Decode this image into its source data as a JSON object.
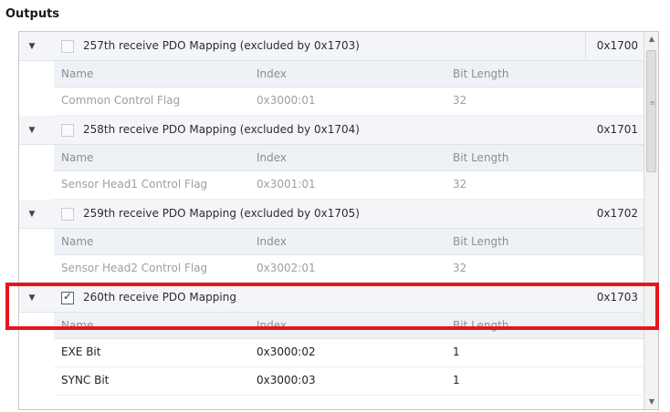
{
  "section": {
    "title": "Outputs"
  },
  "columns": {
    "name": "Name",
    "index": "Index",
    "bit_length": "Bit Length"
  },
  "groups": [
    {
      "title": "257th receive PDO Mapping (excluded by 0x1703)",
      "index": "0x1700",
      "checked": false,
      "rows": [
        {
          "name": "Common Control Flag",
          "index": "0x3000:01",
          "bits": "32"
        }
      ]
    },
    {
      "title": "258th receive PDO Mapping (excluded by 0x1704)",
      "index": "0x1701",
      "checked": false,
      "rows": [
        {
          "name": "Sensor Head1 Control Flag",
          "index": "0x3001:01",
          "bits": "32"
        }
      ]
    },
    {
      "title": "259th receive PDO Mapping (excluded by 0x1705)",
      "index": "0x1702",
      "checked": false,
      "rows": [
        {
          "name": "Sensor Head2 Control Flag",
          "index": "0x3002:01",
          "bits": "32"
        }
      ]
    },
    {
      "title": "260th receive PDO Mapping",
      "index": "0x1703",
      "checked": true,
      "rows": [
        {
          "name": "EXE Bit",
          "index": "0x3000:02",
          "bits": "1"
        },
        {
          "name": "SYNC Bit",
          "index": "0x3000:03",
          "bits": "1"
        }
      ]
    }
  ],
  "colors": {
    "highlight": "#e8141c",
    "header_bg": "#f3f5f8"
  },
  "icons": {
    "toggle": "triangle-down-icon",
    "check": "checkmark-icon"
  }
}
